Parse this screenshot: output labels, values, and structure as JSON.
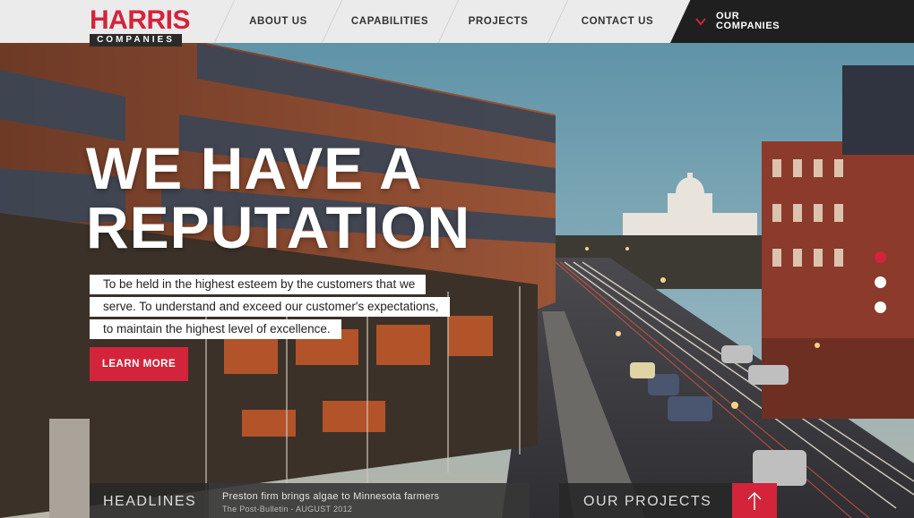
{
  "brand": {
    "logo_top": "HARRIS",
    "logo_bottom": "COMPANIES",
    "accent_color": "#d3243b"
  },
  "nav": {
    "items": [
      {
        "label": "ABOUT US"
      },
      {
        "label": "CAPABILITIES"
      },
      {
        "label": "PROJECTS"
      },
      {
        "label": "CONTACT US"
      }
    ],
    "our_companies": {
      "line1": "OUR",
      "line2": "COMPANIES",
      "icon": "chevron-down-icon"
    }
  },
  "hero": {
    "headline_line1": "WE HAVE A",
    "headline_line2": "REPUTATION",
    "tagline": [
      "To be held in the highest esteem by the customers that we",
      "serve. To understand and exceed our customer's expectations,",
      "to maintain the highest level of excellence."
    ],
    "cta_label": "LEARN MORE",
    "slides_total": 3,
    "slide_active": 1
  },
  "footer": {
    "headlines_label": "HEADLINES",
    "news_title": "Preston firm brings algae to Minnesota farmers",
    "news_source": "The Post-Bulletin - AUGUST 2012",
    "projects_label": "OUR PROJECTS",
    "projects_icon": "arrow-up-icon"
  }
}
